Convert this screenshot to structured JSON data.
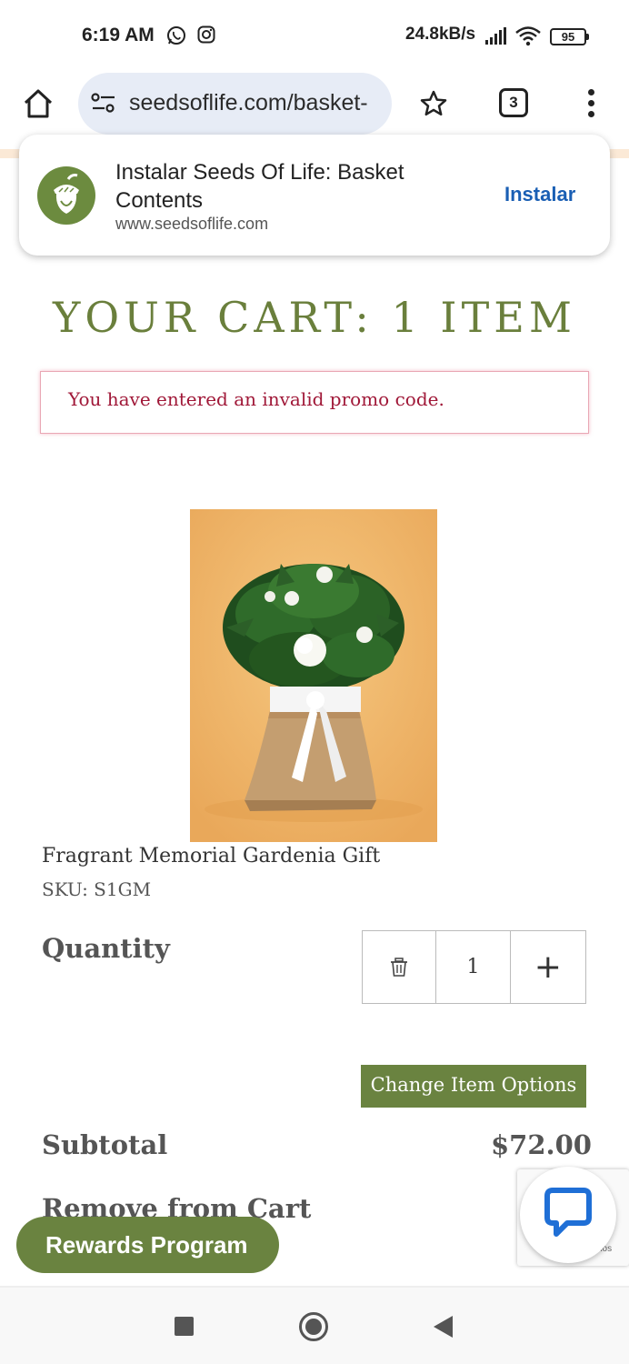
{
  "status_bar": {
    "time": "6:19 AM",
    "net_speed": "24.8kB/s",
    "battery": "95",
    "icons": [
      "whatsapp-icon",
      "instagram-icon",
      "signal-icon",
      "wifi-icon",
      "battery-icon"
    ]
  },
  "browser": {
    "url": "seedsoflife.com/basket-",
    "tab_count": "3",
    "icons": [
      "home-icon",
      "site-settings-icon",
      "bookmark-star-icon",
      "tabs-icon",
      "more-menu-icon"
    ]
  },
  "install_prompt": {
    "title": "Instalar Seeds Of Life: Basket Contents",
    "url": "www.seedsoflife.com",
    "button": "Instalar"
  },
  "cart": {
    "title": "YOUR CART: 1 ITEM",
    "alert": "You have entered an invalid promo code.",
    "item": {
      "name": "Fragrant Memorial Gardenia Gift",
      "sku": "SKU: S1GM",
      "quantity_label": "Quantity",
      "quantity": "1",
      "plus": "+",
      "change_options": "Change Item Options"
    },
    "subtotal_label": "Subtotal",
    "subtotal_value": "$72.00",
    "remove_label": "Remove from Cart"
  },
  "recaptcha_text": "nos",
  "rewards_button": "Rewards Program",
  "colors": {
    "brand_green": "#6a8340",
    "title_green": "#6a7f3c",
    "alert_red": "#a01838",
    "link_blue": "#1a5fb4"
  }
}
